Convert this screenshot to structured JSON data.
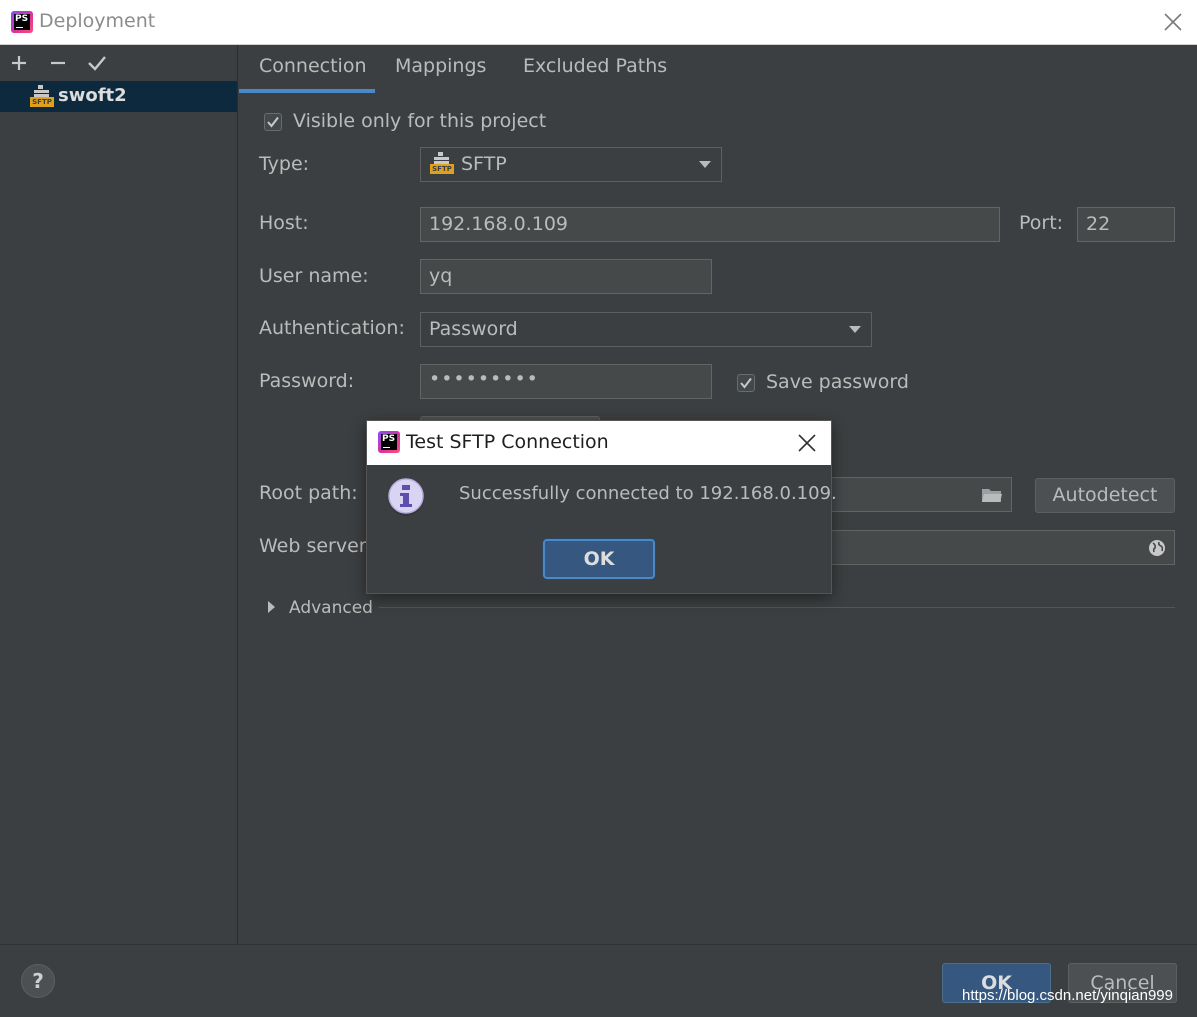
{
  "window": {
    "title": "Deployment"
  },
  "sidebar": {
    "toolbar": [
      {
        "name": "add-icon",
        "glyph": "+"
      },
      {
        "name": "remove-icon",
        "glyph": "−"
      },
      {
        "name": "check-icon",
        "glyph": "✓"
      }
    ],
    "items": [
      {
        "label": "swoft2",
        "icon": "sftp-icon",
        "badge": "SFTP",
        "selected": true
      }
    ]
  },
  "tabs": [
    {
      "label": "Connection",
      "active": true
    },
    {
      "label": "Mappings",
      "active": false
    },
    {
      "label": "Excluded Paths",
      "active": false
    }
  ],
  "connection": {
    "visible_only_label": "Visible only for this project",
    "visible_only_checked": true,
    "type_label": "Type:",
    "type_value": "SFTP",
    "type_badge": "SFTP",
    "host_label": "Host:",
    "host_value": "192.168.0.109",
    "port_label": "Port:",
    "port_value": "22",
    "username_label": "User name:",
    "username_value": "yq",
    "auth_label": "Authentication:",
    "auth_value": "Password",
    "password_label": "Password:",
    "password_value": "•••••••••",
    "save_password_label": "Save password",
    "save_password_checked": true,
    "root_path_label": "Root path:",
    "autodetect_label": "Autodetect",
    "web_server_label": "Web server U",
    "advanced_label": "Advanced"
  },
  "footer": {
    "help_label": "?",
    "ok_label": "OK",
    "cancel_label": "Cancel",
    "watermark": "https://blog.csdn.net/yinqian999"
  },
  "dialog": {
    "title": "Test SFTP Connection",
    "message": "Successfully connected to 192.168.0.109.",
    "ok_label": "OK",
    "icon": "info-icon"
  },
  "colors": {
    "background": "#3c3f41",
    "selection": "#0d293e",
    "accent": "#4a88c7",
    "primary_button": "#365880",
    "sftp_badge": "#e0a01c"
  }
}
